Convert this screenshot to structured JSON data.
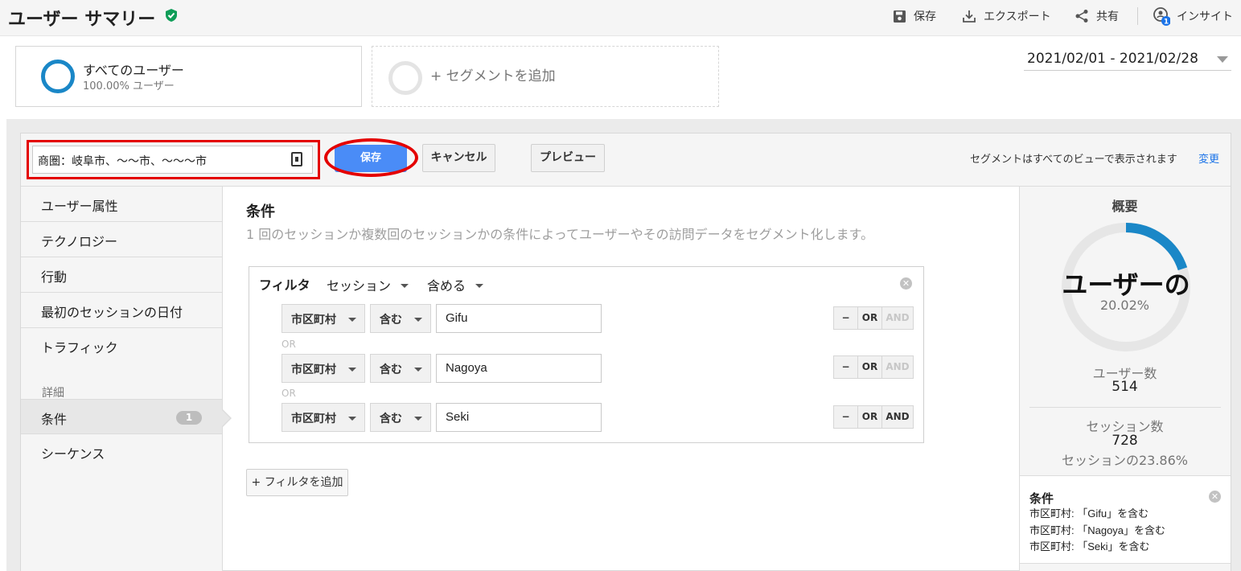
{
  "header": {
    "title": "ユーザー サマリー",
    "actions": {
      "save": "保存",
      "export": "エクスポート",
      "share": "共有",
      "insights": "インサイト",
      "insights_badge": "1"
    }
  },
  "segments": {
    "all_users": {
      "name": "すべてのユーザー",
      "sub": "100.00% ユーザー"
    },
    "add": "+ セグメントを追加"
  },
  "date_range": "2021/02/01 - 2021/02/28",
  "editor": {
    "segment_name": "商圏：岐阜市、～～市、～～～市",
    "save_button": "保存",
    "cancel_button": "キャンセル",
    "preview_button": "プレビュー",
    "visibility_note": "セグメントはすべてのビューで表示されます",
    "change_link": "変更"
  },
  "nav": {
    "items": [
      "ユーザー属性",
      "テクノロジー",
      "行動",
      "最初のセッションの日付",
      "トラフィック"
    ],
    "details_label": "詳細",
    "conditions": {
      "label": "条件",
      "count": "1"
    },
    "sequences": "シーケンス"
  },
  "conditions": {
    "title": "条件",
    "description": "1 回のセッションか複数回のセッションかの条件によってユーザーやその訪問データをセグメント化します。",
    "filter_label": "フィルタ",
    "scope": "セッション",
    "include": "含める",
    "or_label": "OR",
    "rows": [
      {
        "dimension": "市区町村",
        "operator": "含む",
        "value": "Gifu"
      },
      {
        "dimension": "市区町村",
        "operator": "含む",
        "value": "Nagoya"
      },
      {
        "dimension": "市区町村",
        "operator": "含む",
        "value": "Seki"
      }
    ],
    "buttons": {
      "minus": "−",
      "or": "OR",
      "and": "AND"
    },
    "add_filter": "+ フィルタを追加"
  },
  "summary": {
    "title": "概要",
    "donut_label": "ユーザーの",
    "donut_percent": "20.02%",
    "donut_fraction": 0.2002,
    "users_label": "ユーザー数",
    "users_value": "514",
    "sessions_label": "セッション数",
    "sessions_value": "728",
    "sessions_pct": "セッションの23.86%",
    "cond_title": "条件",
    "cond_lines": [
      "市区町村: 「Gifu」を含む",
      "市区町村: 「Nagoya」を含む",
      "市区町村: 「Seki」を含む"
    ]
  },
  "colors": {
    "accent": "#1a87c7",
    "primary_button": "#4a8cf7",
    "highlight": "#e40000",
    "verified": "#0f9d58"
  }
}
